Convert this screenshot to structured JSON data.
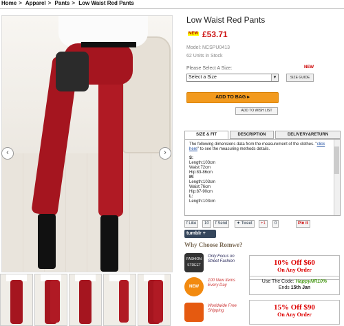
{
  "breadcrumb": {
    "items": [
      "Home",
      "Apparel",
      "Pants",
      "Low Waist Red Pants"
    ],
    "separator": ">"
  },
  "product": {
    "title": "Low Waist Red Pants",
    "new_badge": "NEW",
    "price": "£53.71",
    "model": "Model: NCSPU0413",
    "stock": "62 Units in Stock"
  },
  "size": {
    "label": "Please Select A Size:",
    "new_tag": "NEW",
    "select_value": "Select a Size",
    "size_guide": "SIZE GUIDE"
  },
  "actions": {
    "add_to_bag": "ADD TO BAG ▸",
    "add_to_wishlist": "ADD TO WISH LIST"
  },
  "tabs": [
    {
      "label": "SIZE & FIT"
    },
    {
      "label": "DESCRIPTION"
    },
    {
      "label": "DELIVERY&RETURN"
    }
  ],
  "size_fit": {
    "intro": "The following dimensions data from the measurement of the clothes.",
    "link": "click here",
    "outro": "to see the measuring methods details.",
    "s_head": "S:",
    "s1": "Length:103cm",
    "s2": "Waist:72cm",
    "s3": "Hip:83-86cm",
    "m_head": "M:",
    "m1": "Length:103cm",
    "m2": "Waist:76cm",
    "m3": "Hip:87-90cm",
    "l_head": "L:",
    "l1": "Length:103cm"
  },
  "social": {
    "like": "Like",
    "like_count": "10",
    "send": "Send",
    "tweet": "Tweet",
    "gplus": "+1",
    "gplus_count": "0",
    "pinit": "Pin it",
    "tumblr": "tumblr +"
  },
  "why": {
    "heading": "Why Choose Romwe?",
    "features": [
      {
        "text": "Only Focus on Street Fashion",
        "icon": "fashion-street-icon",
        "badge": "FASHION STREET"
      },
      {
        "text": "100 New Items Every Day",
        "icon": "new-items-icon",
        "badge": "NEW"
      },
      {
        "text": "Worldwide Free Shipping",
        "icon": "truck-icon",
        "badge": ""
      }
    ],
    "promo1_big": "10% Off $60",
    "promo1_small": "On Any Order",
    "code_label": "Use The Code:",
    "code": "HappyNR10%",
    "ends_label": "Ends",
    "ends_date": "15th Jan",
    "promo2_big": "15% Off $90",
    "promo2_small": "On Any Order"
  },
  "colors": {
    "price": "#c11111",
    "bag_button": "#f29a1e",
    "pants": "#a5151f",
    "promo": "#dd0000"
  }
}
